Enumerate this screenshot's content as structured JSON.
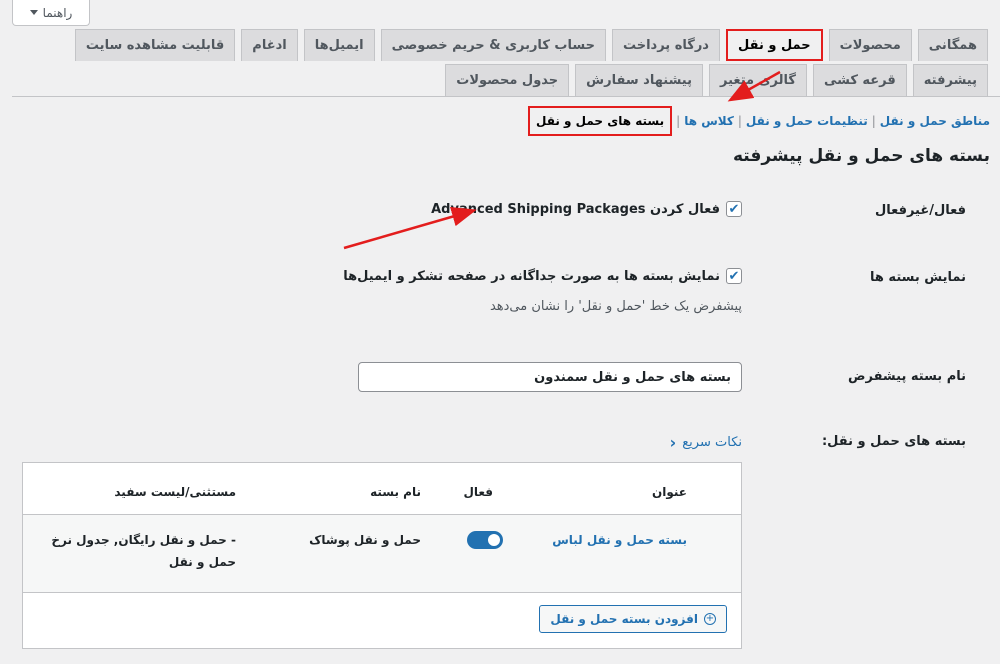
{
  "help": {
    "label": "راهنما"
  },
  "tabs": [
    {
      "label": "همگانی",
      "active": false
    },
    {
      "label": "محصولات",
      "active": false
    },
    {
      "label": "حمل و نقل",
      "active": true
    },
    {
      "label": "درگاه پرداخت",
      "active": false
    },
    {
      "label": "حساب کاربری & حریم خصوصی",
      "active": false
    },
    {
      "label": "ایمیل‌ها",
      "active": false
    },
    {
      "label": "ادغام",
      "active": false
    },
    {
      "label": "قابلیت مشاهده سایت",
      "active": false
    },
    {
      "label": "پیشرفته",
      "active": false
    },
    {
      "label": "قرعه کشی",
      "active": false
    },
    {
      "label": "گالری متغیر",
      "active": false
    },
    {
      "label": "پیشنهاد سفارش",
      "active": false
    },
    {
      "label": "جدول محصولات",
      "active": false
    }
  ],
  "subnav": {
    "zones": "مناطق حمل و نقل",
    "options": "تنظیمات حمل و نقل",
    "classes": "کلاس ها",
    "packages": "بسته های حمل و نقل"
  },
  "page_title": "بسته های حمل و نقل پیشرفته",
  "enable": {
    "label": "فعال/غیرفعال",
    "checkbox_label": "فعال کردن Advanced Shipping Packages"
  },
  "display": {
    "label": "نمایش بسته ها",
    "checkbox_label": "نمایش بسته ها به صورت جداگانه در صفحه تشکر و ایمیل‌ها",
    "description": "پیشفرض یک خط 'حمل و نقل' را نشان می‌دهد"
  },
  "default_name": {
    "label": "نام بسته پیشفرض",
    "value": "بسته های حمل و نقل سمندون"
  },
  "packages": {
    "label": "بسته های حمل و نقل:",
    "quick_tips": "نکات سریع",
    "columns": {
      "title": "عنوان",
      "active": "فعال",
      "package_name": "نام بسته",
      "exclusion": "مستثنی/لیست سفید"
    },
    "rows": [
      {
        "title": "بسته حمل و نقل لباس",
        "active": true,
        "package_name": "حمل و نقل پوشاک",
        "exclusion_line1": "- حمل و نقل رایگان, جدول نرخ",
        "exclusion_line2": "حمل و نقل"
      }
    ],
    "add_button": "افزودن بسته حمل و نقل"
  },
  "colors": {
    "accent": "#2271b1",
    "highlight": "#e31d1d",
    "background": "#f0f0f1"
  }
}
